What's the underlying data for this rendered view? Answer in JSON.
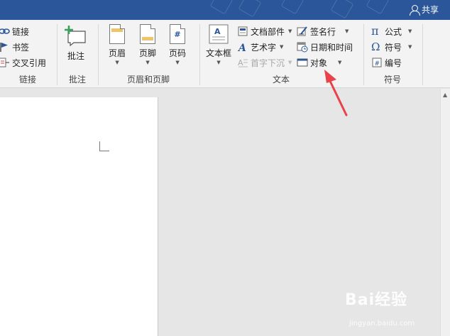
{
  "titlebar": {
    "share_label": "共享",
    "color": "#2b579a"
  },
  "groups": {
    "links": {
      "label": "链接",
      "items": [
        {
          "label": "链接",
          "icon": "link-icon"
        },
        {
          "label": "书签",
          "icon": "bookmark-icon"
        },
        {
          "label": "交叉引用",
          "icon": "cross-reference-icon"
        }
      ]
    },
    "comments": {
      "label": "批注",
      "new_comment": "批注"
    },
    "header_footer": {
      "label": "页眉和页脚",
      "header": "页眉",
      "footer": "页脚",
      "page_number": "页码"
    },
    "text": {
      "label": "文本",
      "text_box": "文本框",
      "quick_parts": "文档部件",
      "wordart": "艺术字",
      "drop_cap": "首字下沉",
      "signature_line": "签名行",
      "date_time": "日期和时间",
      "object": "对象"
    },
    "symbols": {
      "label": "符号",
      "equation": "公式",
      "symbol": "符号",
      "number": "编号"
    }
  },
  "watermark": {
    "brand": "Bai经验",
    "url": "jingyan.baidu.com"
  },
  "annotation_color": "#e8424a"
}
